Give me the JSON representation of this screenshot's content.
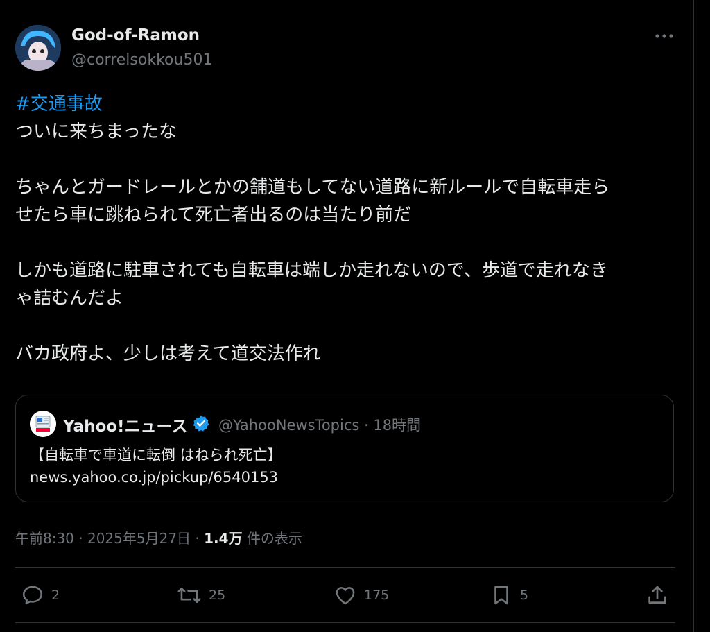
{
  "author": {
    "display_name": "God-of-Ramon",
    "handle": "@correlsokkou501",
    "avatar_icon": "anime-avatar-icon"
  },
  "post": {
    "hashtag": "#交通事故",
    "lines": [
      "ついに来ちまったな",
      "",
      "ちゃんとガードレールとかの舗道もしてない道路に新ルールで自転車走ら",
      "せたら車に跳ねられて死亡者出るのは当たり前だ",
      "",
      "しかも道路に駐車されても自転車は端しか走れないので、歩道で走れなき",
      "ゃ詰むんだよ",
      "",
      "バカ政府よ、少しは考えて道交法作れ"
    ]
  },
  "quote": {
    "name": "Yahoo!ニュース",
    "handle_time": "@YahooNewsTopics · 18時間",
    "title": "【自転車で車道に転倒 はねられ死亡】",
    "url": "news.yahoo.co.jp/pickup/6540153"
  },
  "meta": {
    "time_date": "午前8:30 · 2025年5月27日 ·",
    "views": "1.4万",
    "views_label": "件の表示"
  },
  "actions": {
    "replies": "2",
    "reposts": "25",
    "likes": "175",
    "bookmarks": "5"
  },
  "colors": {
    "background": "#000000",
    "text": "#e7e9ea",
    "muted": "#71767b",
    "link": "#1d9bf0",
    "border": "#2f3336"
  }
}
